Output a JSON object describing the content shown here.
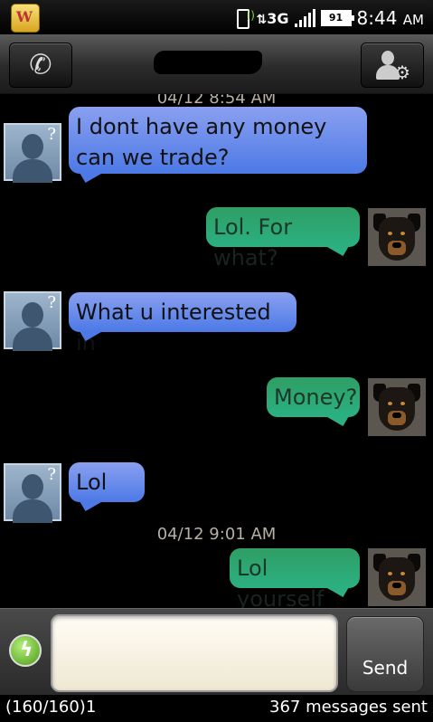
{
  "statusbar": {
    "app_notification_icon": "words-with-friends-icon",
    "network": "3G",
    "battery": "91",
    "time": "8:44",
    "ampm": "AM"
  },
  "header": {
    "call_icon": "phone-icon",
    "contact_icon": "contact-settings-icon"
  },
  "conversation": {
    "top_date_partial": "04/12 8:54 AM",
    "date_2": "04/12 9:01 AM",
    "messages": [
      {
        "dir": "in",
        "text_line1": "I dont have any money",
        "text_line2": "can we trade?"
      },
      {
        "dir": "out",
        "text": "Lol. For what?"
      },
      {
        "dir": "in",
        "text": "What u interested in"
      },
      {
        "dir": "out",
        "text": "Money?"
      },
      {
        "dir": "in",
        "text": "Lol"
      },
      {
        "dir": "out",
        "text": "Lol yourself"
      }
    ]
  },
  "compose": {
    "placeholder": "",
    "send_label": "Send",
    "attach_icon": "lightning-icon"
  },
  "info": {
    "char_counter": "(160/160)1",
    "sent_count": "367 messages sent"
  }
}
